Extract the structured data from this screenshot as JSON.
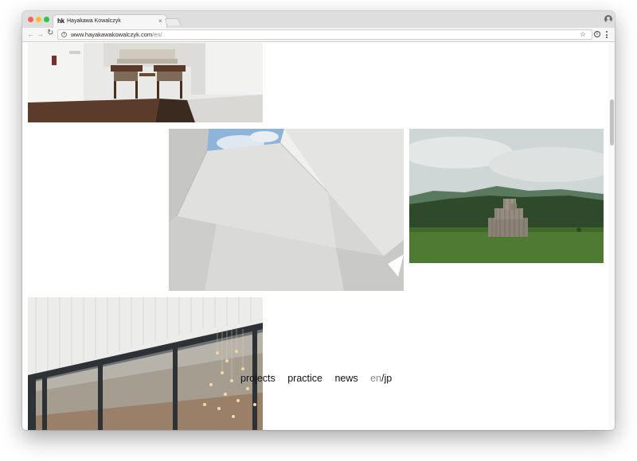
{
  "browser": {
    "tab": {
      "logo": "hk",
      "title": "Hayakawa Kowalczyk",
      "close": "×"
    },
    "address": {
      "host": "www.hayakawakowalczyk.com",
      "path": "/en/"
    },
    "nav_icons": {
      "back": "back-arrow-icon",
      "forward": "forward-arrow-icon",
      "reload": "reload-icon",
      "bookmark": "star-icon",
      "menu": "kebab-menu-icon"
    }
  },
  "site_nav": {
    "projects": "projects",
    "practice": "practice",
    "news": "news",
    "lang_en": "en",
    "lang_sep": "/",
    "lang_jp": "jp"
  },
  "gallery": [
    {
      "subject": "interior-lounge"
    },
    {
      "subject": "white-skylight-interior"
    },
    {
      "subject": "wooden-pavilion-in-field"
    },
    {
      "subject": "glass-facade-with-lights"
    }
  ],
  "colors": {
    "traffic_red": "#fe5f57",
    "traffic_yellow": "#febc2e",
    "traffic_green": "#28c840",
    "lang_inactive": "#8a8a8a"
  }
}
